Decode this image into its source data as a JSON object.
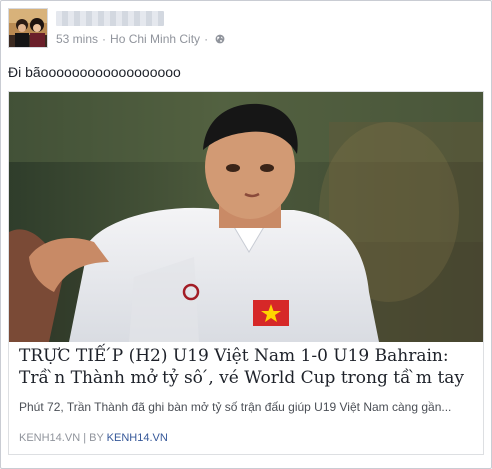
{
  "post": {
    "time": "53 mins",
    "location": "Ho Chi Minh City",
    "separator": "·",
    "privacy_icon": "globe-icon",
    "text": "Đi bãoooooooooooooooooo"
  },
  "card": {
    "title": "TRỰC TIẾ ́P (H2) U19 Việt Nam 1-0 U19 Bahrain: Trầ ̀n Thành mở tỷ sô ́, vé World Cup trong tầ ̀m tay",
    "description": "Phút 72, Trần Thành đã ghi bàn mở tỷ số trận đấu giúp U19 Việt Nam càng gần...",
    "source_domain": "KENH14.VN",
    "by_label": "BY",
    "by_link": "KENH14.VN",
    "source_sep": "|"
  },
  "colors": {
    "link": "#365899",
    "meta_text": "#90949c",
    "border": "#c9ccd3"
  }
}
